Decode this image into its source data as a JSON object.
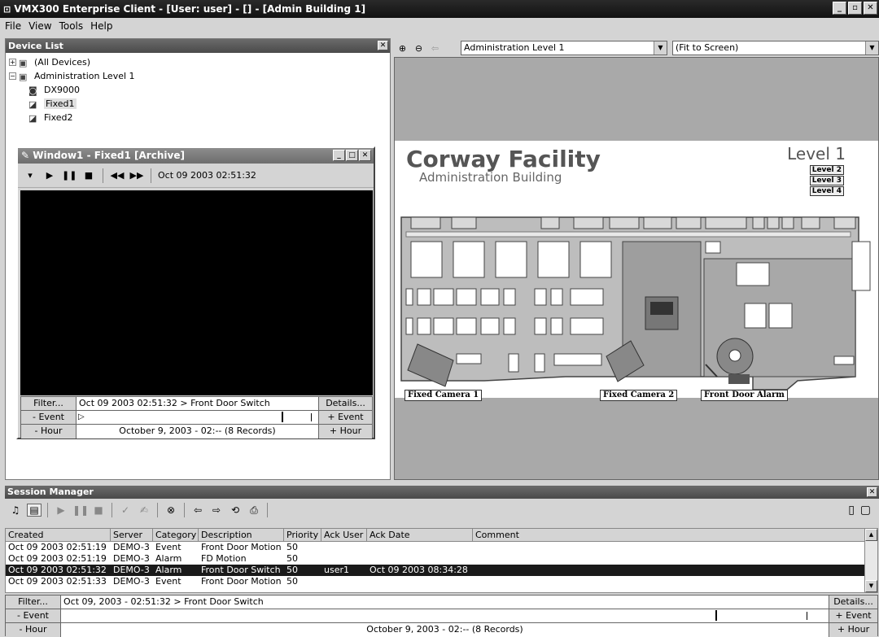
{
  "window": {
    "title": "VMX300 Enterprise Client - [User: user] - [] - [Admin Building 1]",
    "min": "_",
    "max": "▫",
    "close": "✕"
  },
  "menu": [
    "File",
    "View",
    "Tools",
    "Help"
  ],
  "device_list": {
    "title": "Device List",
    "close": "✕",
    "items": [
      {
        "label": "(All Devices)",
        "expander": "+"
      },
      {
        "label": "Administration Level 1",
        "expander": "−"
      },
      {
        "label": "DX9000"
      },
      {
        "label": "Fixed1"
      },
      {
        "label": "Fixed2"
      }
    ]
  },
  "video_window": {
    "title": "Window1 - Fixed1 [Archive]",
    "timestamp": "Oct 09 2003  02:51:32",
    "filter_label": "Filter...",
    "filter_text": "Oct 09 2003  02:51:32 > Front Door Switch",
    "details_label": "Details...",
    "minus_event": "- Event",
    "plus_event": "+ Event",
    "minus_hour": "- Hour",
    "plus_hour": "+ Hour",
    "hour_text": "October 9, 2003 - 02:-- (8 Records)"
  },
  "map": {
    "level_select": "Administration Level 1",
    "zoom_select": "(Fit to Screen)",
    "title": "Corway Facility",
    "subtitle": "Administration Building",
    "level": "Level 1",
    "level_links": [
      "Level 2",
      "Level 3",
      "Level 4"
    ],
    "labels": {
      "cam1": "Fixed Camera 1",
      "cam2": "Fixed Camera 2",
      "alarm": "Front Door Alarm"
    }
  },
  "session_manager": {
    "title": "Session Manager",
    "close": "✕",
    "columns": [
      "Created",
      "Server",
      "Category",
      "Description",
      "Priority",
      "Ack User",
      "Ack Date",
      "Comment"
    ],
    "rows": [
      {
        "created": "Oct 09 2003  02:51:19",
        "server": "DEMO-3",
        "category": "Event",
        "description": "Front Door Motion",
        "priority": "50",
        "ack_user": "",
        "ack_date": "",
        "comment": ""
      },
      {
        "created": "Oct 09 2003  02:51:19",
        "server": "DEMO-3",
        "category": "Alarm",
        "description": "FD Motion",
        "priority": "50",
        "ack_user": "",
        "ack_date": "",
        "comment": ""
      },
      {
        "created": "Oct 09 2003  02:51:32",
        "server": "DEMO-3",
        "category": "Alarm",
        "description": "Front Door Switch",
        "priority": "50",
        "ack_user": "user1",
        "ack_date": "Oct 09 2003  08:34:28",
        "comment": ""
      },
      {
        "created": "Oct 09 2003  02:51:33",
        "server": "DEMO-3",
        "category": "Event",
        "description": "Front Door Motion",
        "priority": "50",
        "ack_user": "",
        "ack_date": "",
        "comment": ""
      }
    ],
    "filter_label": "Filter...",
    "filter_text": "Oct 09, 2003 - 02:51:32 > Front Door Switch",
    "details_label": "Details...",
    "minus_event": "- Event",
    "plus_event": "+ Event",
    "minus_hour": "- Hour",
    "plus_hour": "+ Hour",
    "hour_text": "October 9, 2003 - 02:-- (8 Records)"
  }
}
